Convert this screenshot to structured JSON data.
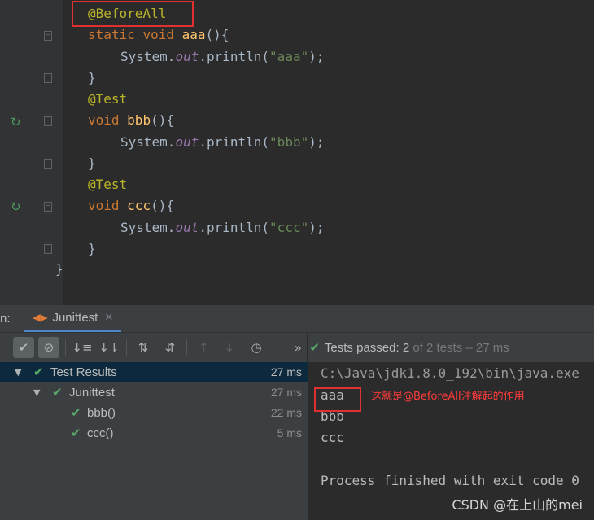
{
  "editor": {
    "lines": [
      {
        "ann": "@BeforeAll"
      },
      {
        "kw1": "static",
        "kw2": "void",
        "fn": "aaa",
        "rest": "(){"
      },
      {
        "pre": "System.",
        "field": "out",
        "mid": ".println(",
        "str": "\"aaa\"",
        "end": ");"
      },
      {
        "text": "}"
      },
      {
        "ann": "@Test"
      },
      {
        "kw": "void",
        "fn": "bbb",
        "rest": "(){"
      },
      {
        "pre": "System.",
        "field": "out",
        "mid": ".println(",
        "str": "\"bbb\"",
        "end": ");"
      },
      {
        "text": "}"
      },
      {
        "ann": "@Test"
      },
      {
        "kw": "void",
        "fn": "ccc",
        "rest": "(){"
      },
      {
        "pre": "System.",
        "field": "out",
        "mid": ".println(",
        "str": "\"ccc\"",
        "end": ");"
      },
      {
        "text": "}"
      },
      {
        "text": "}"
      }
    ]
  },
  "run_panel": {
    "prefix": "n:",
    "tab_label": "Junittest",
    "status": {
      "label": "Tests passed:",
      "count": "2",
      "rest": "of 2 tests – 27 ms"
    },
    "tree": [
      {
        "name": "Test Results",
        "time": "27 ms"
      },
      {
        "name": "Junittest",
        "time": "27 ms"
      },
      {
        "name": "bbb()",
        "time": "22 ms"
      },
      {
        "name": "ccc()",
        "time": "5 ms"
      }
    ],
    "console": {
      "command": "C:\\Java\\jdk1.8.0_192\\bin\\java.exe",
      "outputs": [
        "aaa",
        "bbb",
        "ccc"
      ],
      "exit": "Process finished with exit code 0"
    }
  },
  "annotation_note": "这就是@BeforeAll注解起的作用",
  "watermark": "CSDN @在上山的mei",
  "colors": {
    "highlight_box": "#e03030",
    "pass_green": "#59a869",
    "selection": "#0d293e"
  }
}
